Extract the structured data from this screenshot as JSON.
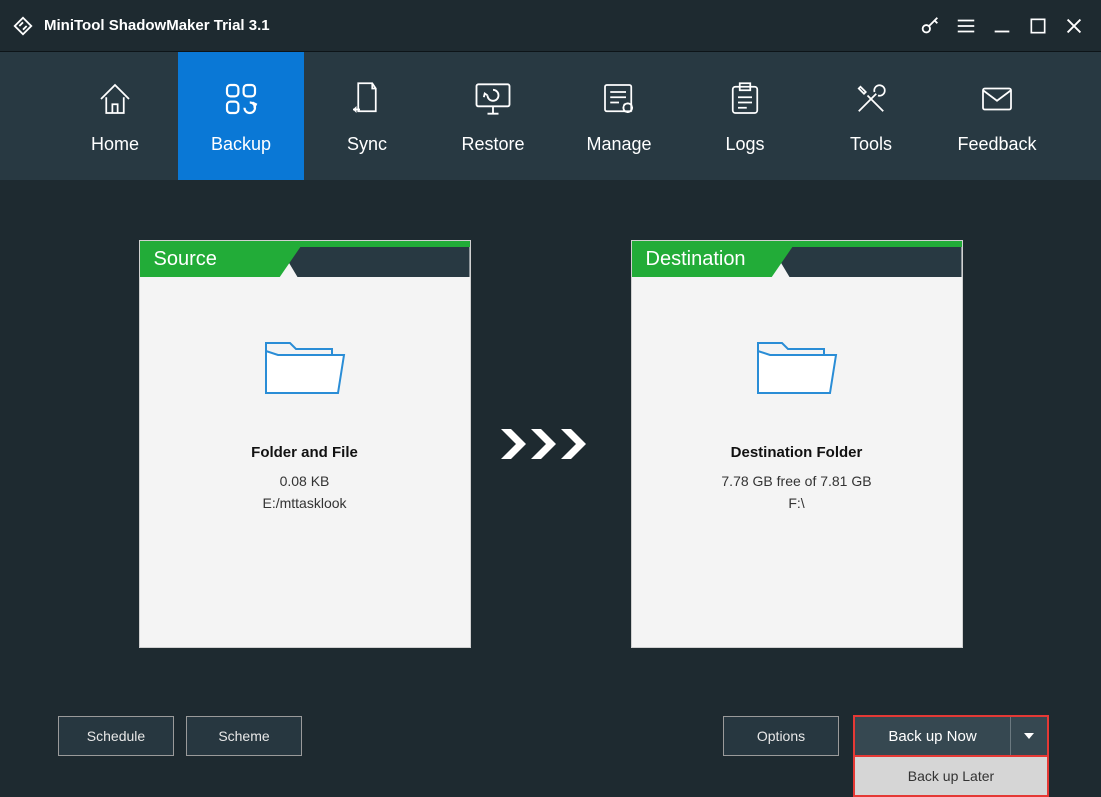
{
  "title": "MiniTool ShadowMaker Trial 3.1",
  "nav": {
    "home": "Home",
    "backup": "Backup",
    "sync": "Sync",
    "restore": "Restore",
    "manage": "Manage",
    "logs": "Logs",
    "tools": "Tools",
    "feedback": "Feedback"
  },
  "source": {
    "header": "Source",
    "title": "Folder and File",
    "size": "0.08 KB",
    "path": "E:/mttasklook"
  },
  "destination": {
    "header": "Destination",
    "title": "Destination Folder",
    "freespace": "7.78 GB free of 7.81 GB",
    "path": "F:\\"
  },
  "buttons": {
    "schedule": "Schedule",
    "scheme": "Scheme",
    "options": "Options",
    "backup_now": "Back up Now",
    "backup_later": "Back up Later"
  }
}
